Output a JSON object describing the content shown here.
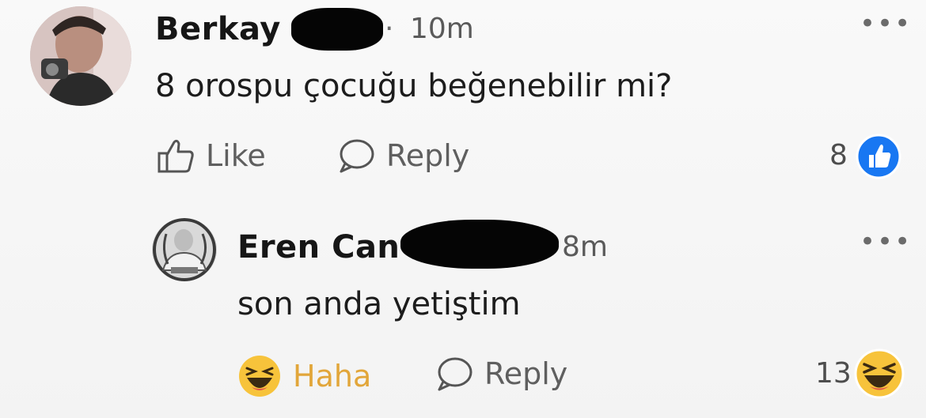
{
  "comments": [
    {
      "author": "Berkay",
      "time": "10m",
      "text": "8 orospu çocuğu beğenebilir mi?",
      "actions": {
        "like": "Like",
        "reply": "Reply"
      },
      "reaction_count": "8",
      "reaction_type": "like-icon"
    },
    {
      "author": "Eren Can",
      "time": "8m",
      "text": "son anda yetiştim",
      "actions": {
        "reaction": "Haha",
        "reply": "Reply"
      },
      "reaction_count": "13",
      "reaction_type": "haha-icon"
    }
  ],
  "colors": {
    "like_blue": "#1877f2",
    "haha_yellow": "#f7c33b",
    "haha_label": "#e2a63a"
  },
  "more_label": "•••",
  "separator": "·"
}
